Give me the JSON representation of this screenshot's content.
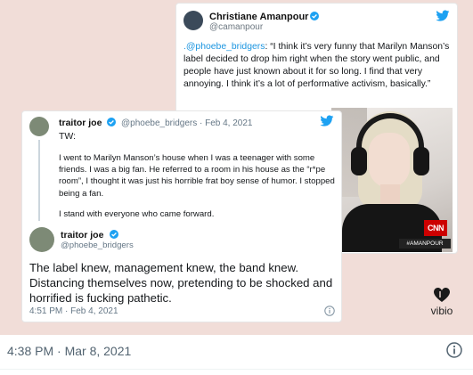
{
  "back_tweet": {
    "name": "Christiane Amanpour",
    "handle": "@camanpour",
    "mention": ".@phoebe_bridgers",
    "quote": ": “I think it’s very funny that Marilyn Manson’s label decided to drop him right when the story went public, and people have just known about it for so long. I find that very annoying. I think it’s a lot of performative activism, basically.”",
    "photo_badge": "CNN",
    "photo_tag": "#AMANPOUR"
  },
  "front_tweet": {
    "name": "traitor joe",
    "handle_date": "@phoebe_bridgers · Feb 4, 2021",
    "tw": "TW:",
    "para1": "I went to Marilyn Manson’s house when I was a teenager with some friends. I was a big fan. He referred to a room in his house as the “r*pe room”, I thought it was just his horrible frat boy sense of humor. I stopped being a fan.",
    "para2": "I stand with everyone who came forward.",
    "name2": "traitor joe",
    "handle2": "@phoebe_bridgers",
    "main_text": "The label knew, management knew, the band knew. Distancing themselves now, pretending to be shocked and horrified is fucking pathetic.",
    "timestamp": "4:51 PM · Feb 4, 2021"
  },
  "watermark": {
    "label": "vibio"
  },
  "footer": {
    "timestamp": "4:38 PM · Mar 8, 2021"
  },
  "colors": {
    "link": "#1b95e0",
    "verified": "#1da1f2",
    "media_bg": "#f1ddd8"
  },
  "icons": [
    "verified-badge-icon",
    "twitter-bird-icon",
    "info-icon",
    "vibio-heart-icon"
  ]
}
